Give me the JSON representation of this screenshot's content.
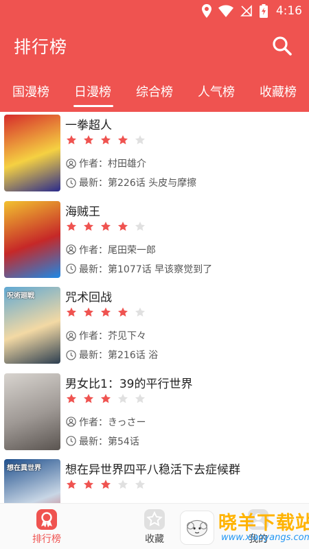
{
  "status_bar": {
    "time": "4:16"
  },
  "header": {
    "title": "排行榜"
  },
  "tabs": [
    {
      "label": "国漫榜",
      "active": false
    },
    {
      "label": "日漫榜",
      "active": true
    },
    {
      "label": "综合榜",
      "active": false
    },
    {
      "label": "人气榜",
      "active": false
    },
    {
      "label": "收藏榜",
      "active": false
    }
  ],
  "comics": [
    {
      "title": "一拳超人",
      "rating": 4,
      "author": "作者：村田雄介",
      "latest": "最新：第226话 头皮与摩擦",
      "cover_text": "",
      "cover_colors": [
        "#d62b2b",
        "#f5d142",
        "#2a2a8c"
      ]
    },
    {
      "title": "海贼王",
      "rating": 4,
      "author": "作者：尾田荣一郎",
      "latest": "最新：第1077话 早该察觉到了",
      "cover_text": "",
      "cover_colors": [
        "#f2c230",
        "#c62828",
        "#1e88e5"
      ]
    },
    {
      "title": "咒术回战",
      "rating": 4,
      "author": "作者：芥见下々",
      "latest": "最新：第216话 浴",
      "cover_text": "呪術廻戦",
      "cover_colors": [
        "#5fa8d3",
        "#f3d9a4",
        "#2c3e50"
      ]
    },
    {
      "title": "男女比1：39的平行世界",
      "rating": 3,
      "author": "作者：きっさー",
      "latest": "最新：第54话",
      "cover_text": "",
      "cover_colors": [
        "#d8d4cf",
        "#9e9894",
        "#5a5450"
      ]
    },
    {
      "title": "想在异世界四平八稳活下去症候群",
      "rating": 3,
      "author": "",
      "latest": "",
      "cover_text": "想在異世界",
      "cover_colors": [
        "#1f4f8c",
        "#c8d6e5",
        "#d32f2f"
      ]
    }
  ],
  "bottom_nav": [
    {
      "label": "排行榜",
      "active": true
    },
    {
      "label": "收藏",
      "active": false
    },
    {
      "label": "我的",
      "active": false
    }
  ],
  "watermark": {
    "title": "晓羊下载站",
    "url": "www.xiaoyangs.com"
  },
  "colors": {
    "brand": "#ef5350",
    "star_on": "#ef5350",
    "star_off": "#e0e0e0",
    "nav_active": "#ef5350",
    "nav_inactive": "#444444"
  }
}
